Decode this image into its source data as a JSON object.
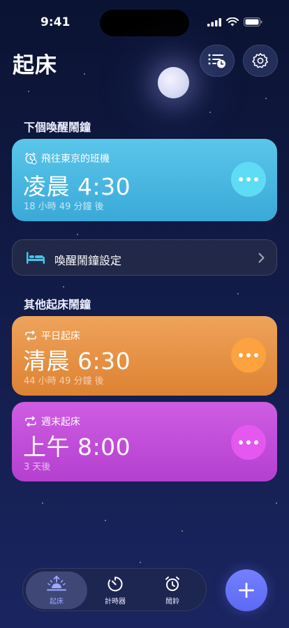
{
  "status": {
    "time": "9:41"
  },
  "header": {
    "title": "起床"
  },
  "next_alarm": {
    "section_title": "下個喚醒鬧鐘",
    "label": "飛往東京的班機",
    "time": "凌晨 4:30",
    "countdown": "18 小時 49 分鐘 後",
    "color": "#46b4e0"
  },
  "settings_row": {
    "label": "喚醒鬧鐘設定"
  },
  "other_alarms": {
    "section_title": "其他起床鬧鐘",
    "items": [
      {
        "label": "平日起床",
        "time": "清晨 6:30",
        "countdown": "44 小時 49 分鐘 後",
        "color": "#e4893b"
      },
      {
        "label": "週末起床",
        "time": "上午 8:00",
        "countdown": "3 天後",
        "color": "#c04cd8"
      }
    ]
  },
  "tabs": [
    {
      "label": "起床",
      "icon": "sunrise-icon",
      "active": true
    },
    {
      "label": "計時器",
      "icon": "timer-icon",
      "active": false
    },
    {
      "label": "鬧鈴",
      "icon": "alarm-clock-icon",
      "active": false
    }
  ],
  "colors": {
    "accent": "#6873f8",
    "background": "#121b47"
  }
}
